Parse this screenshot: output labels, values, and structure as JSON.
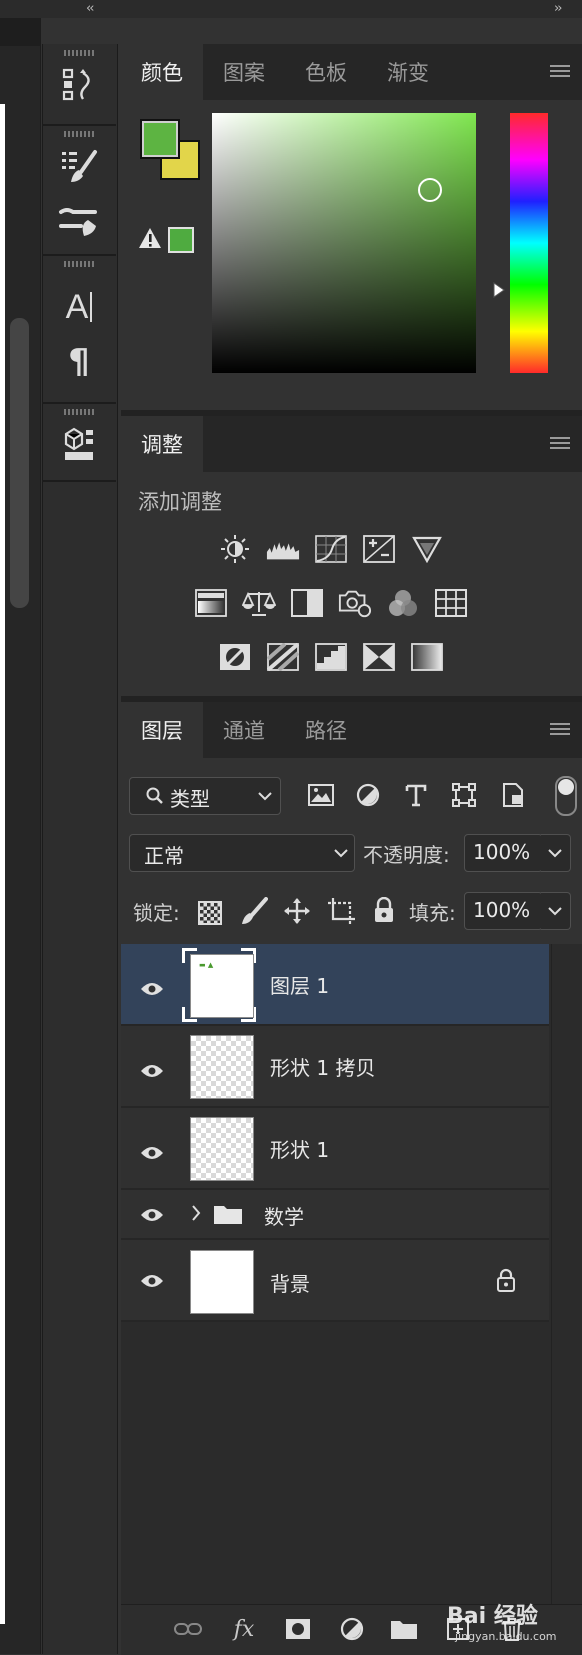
{
  "color_panel": {
    "tabs": [
      "颜色",
      "图案",
      "色板",
      "渐变"
    ],
    "active_tab": "颜色",
    "foreground_color": "#5db442",
    "background_color": "#e2d54a",
    "websafe_swatch_color": "#4fab40",
    "field_hue": "#7fe64f"
  },
  "adjustments_panel": {
    "tab": "调整",
    "add_label": "添加调整"
  },
  "layers_panel": {
    "tabs": [
      "图层",
      "通道",
      "路径"
    ],
    "active_tab": "图层",
    "filter_type": "类型",
    "blend_mode": "正常",
    "opacity_label": "不透明度:",
    "opacity_value": "100%",
    "lock_label": "锁定:",
    "fill_label": "填充:",
    "fill_value": "100%",
    "layers": [
      {
        "name": "图层 1",
        "type": "white"
      },
      {
        "name": "形状 1 拷贝",
        "type": "checker"
      },
      {
        "name": "形状 1",
        "type": "checker"
      },
      {
        "name": "数学",
        "type": "group"
      },
      {
        "name": "背景",
        "type": "white"
      }
    ],
    "footer_fx": "fx"
  },
  "watermark": {
    "text": "Bai 经验",
    "url": "jingyan.baidu.com"
  },
  "icons": {
    "collapse_left": "double-chevron-left-icon",
    "collapse_right": "double-chevron-right-icon"
  }
}
